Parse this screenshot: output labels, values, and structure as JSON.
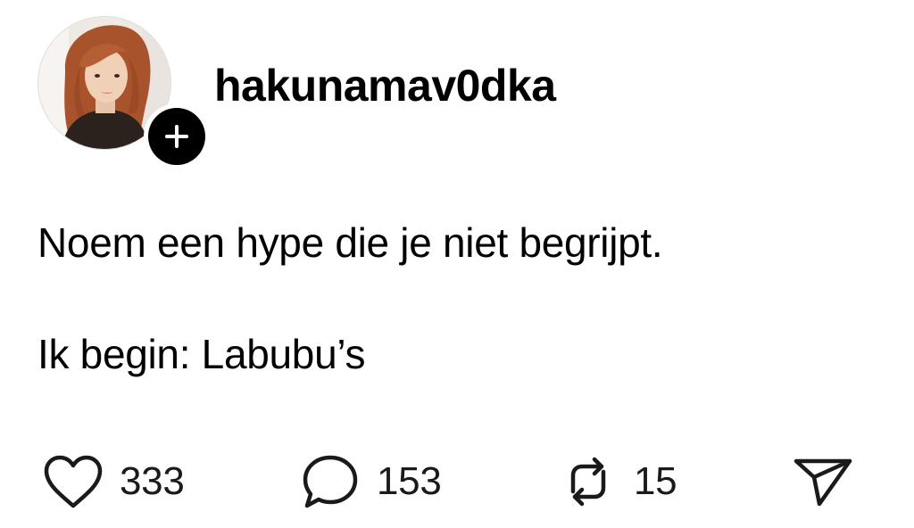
{
  "post": {
    "author": {
      "username": "hakunamav0dka",
      "avatar_icon": "user-avatar-photo",
      "follow_icon": "plus-icon"
    },
    "text_lines": [
      "Noem een hype die je niet begrijpt.",
      "Ik begin: Labubu’s"
    ],
    "actions": {
      "like": {
        "icon": "heart-icon",
        "count": "333"
      },
      "comment": {
        "icon": "comment-icon",
        "count": "153"
      },
      "repost": {
        "icon": "repost-icon",
        "count": "15"
      },
      "share": {
        "icon": "send-icon"
      }
    }
  },
  "colors": {
    "text": "#000000",
    "background": "#ffffff",
    "badge": "#000000"
  }
}
